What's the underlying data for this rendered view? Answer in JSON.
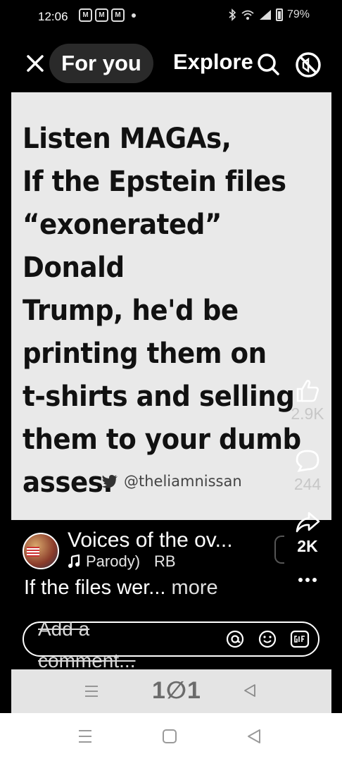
{
  "status_bar": {
    "time": "12:06",
    "notification_badges": [
      "M",
      "M",
      "M"
    ],
    "battery": "79%"
  },
  "top_nav": {
    "tabs": [
      {
        "label": "For you",
        "active": true
      },
      {
        "label": "Explore",
        "active": false
      }
    ]
  },
  "post": {
    "headline_lines": [
      "Listen MAGAs,",
      "If the Epstein files",
      "“exonerated” Donald",
      "Trump, he'd be",
      "printing them on",
      "t-shirts and selling",
      "them to your dumb",
      "asses."
    ],
    "handle": "@theliamnissan"
  },
  "actions": {
    "likes": "2.9K",
    "comments": "244",
    "shares": "2K"
  },
  "creator": {
    "name": "Voices of the ov...",
    "sound": "Parody)",
    "sound_suffix": "RB"
  },
  "caption": {
    "text": "If the files wer...",
    "more": "more"
  },
  "comment": {
    "placeholder": "Add a comment..."
  },
  "pager": {
    "text": "1∅1"
  },
  "colors": {
    "background": "#000000",
    "post_bg": "#e9e9e9",
    "headline": "#111111",
    "pager_bg": "#e4e4e4"
  }
}
